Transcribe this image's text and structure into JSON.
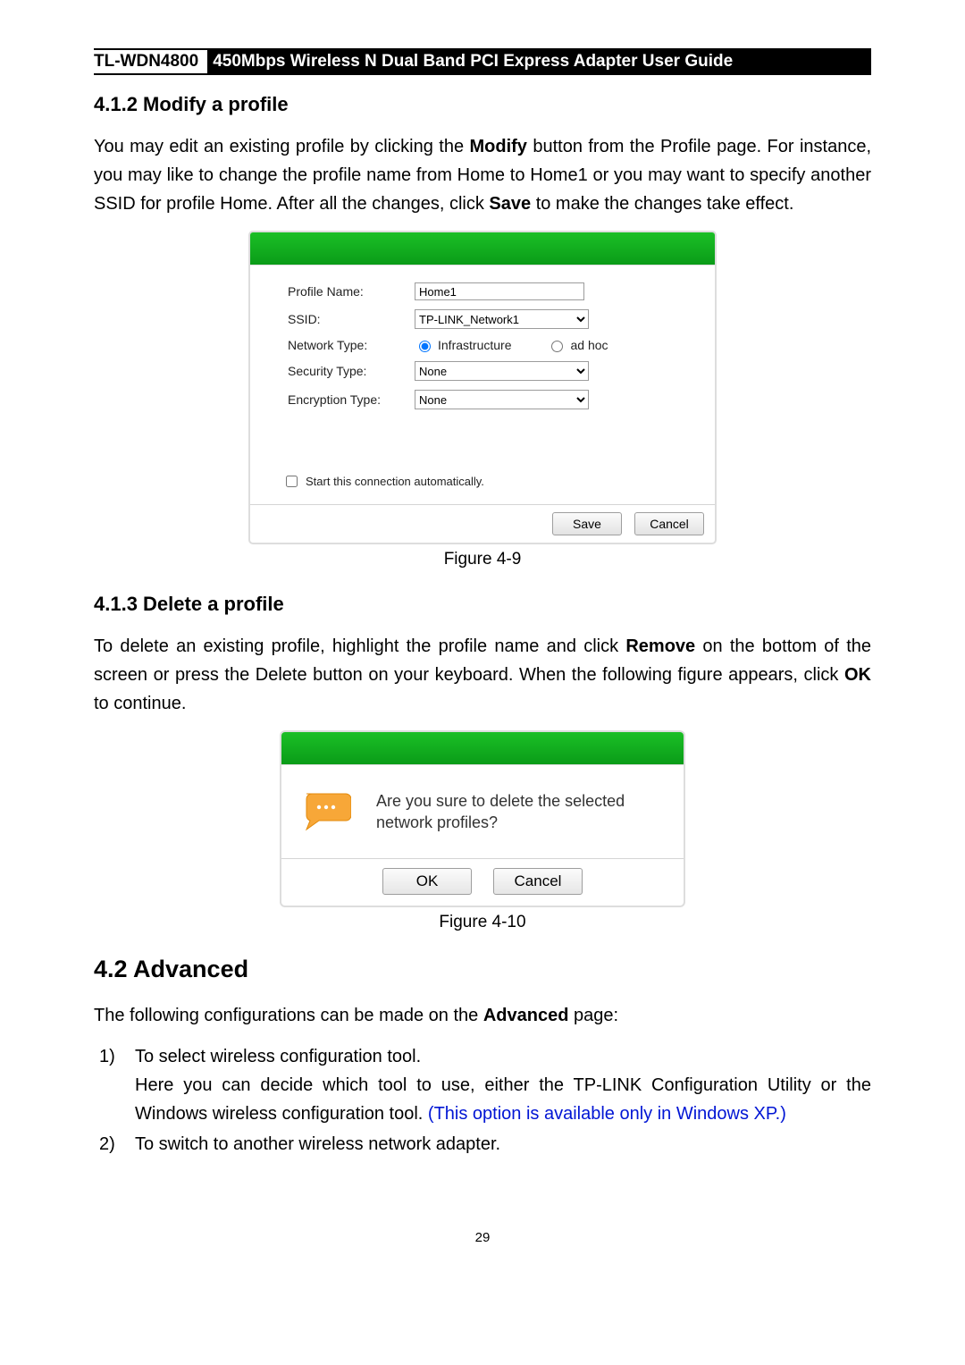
{
  "header": {
    "model": "TL-WDN4800",
    "title": "450Mbps Wireless N Dual Band PCI Express Adapter User Guide"
  },
  "section412": {
    "num_title": "4.1.2  Modify a profile",
    "para_pre": "You may edit an existing profile by clicking the ",
    "modify": "Modify",
    "para_mid": " button from the Profile page. For instance, you may like to change the profile name from Home to Home1 or you may want to specify another SSID for profile Home. After all the changes, click ",
    "save": "Save",
    "para_post": " to make the changes take effect."
  },
  "fig49": {
    "caption": "Figure 4-9",
    "labels": {
      "profile_name": "Profile Name:",
      "ssid": "SSID:",
      "network_type": "Network Type:",
      "security_type": "Security Type:",
      "encryption_type": "Encryption Type:"
    },
    "values": {
      "profile_name": "Home1",
      "ssid": "TP-LINK_Network1",
      "network_type": "Infrastructure",
      "network_type_alt": "ad hoc",
      "security_type": "None",
      "encryption_type": "None"
    },
    "checkbox_label": "Start this connection automatically.",
    "buttons": {
      "save": "Save",
      "cancel": "Cancel"
    }
  },
  "section413": {
    "num_title": "4.1.3  Delete a profile",
    "para_pre": "To delete an existing profile, highlight the profile name and click ",
    "remove": "Remove",
    "para_mid": " on the bottom of the screen or press the Delete button on your keyboard. When the following figure appears, click ",
    "ok": "OK",
    "para_post": " to continue."
  },
  "fig410": {
    "caption": "Figure 4-10",
    "text": "Are you sure to delete the selected network profiles?",
    "buttons": {
      "ok": "OK",
      "cancel": "Cancel"
    }
  },
  "section42": {
    "num_title": "4.2  Advanced",
    "intro_pre": "The following configurations can be made on the ",
    "advanced": "Advanced",
    "intro_post": " page:",
    "item1_num": "1)",
    "item1_line1": "To select wireless configuration tool.",
    "item1_line2": "Here you can decide which tool to use, either the TP-LINK Configuration Utility or the Windows wireless configuration tool.   ",
    "item1_note": "(This option is available only in Windows XP.)",
    "item2_num": "2)",
    "item2_line1": "To switch to another wireless network adapter."
  },
  "page_number": "29"
}
